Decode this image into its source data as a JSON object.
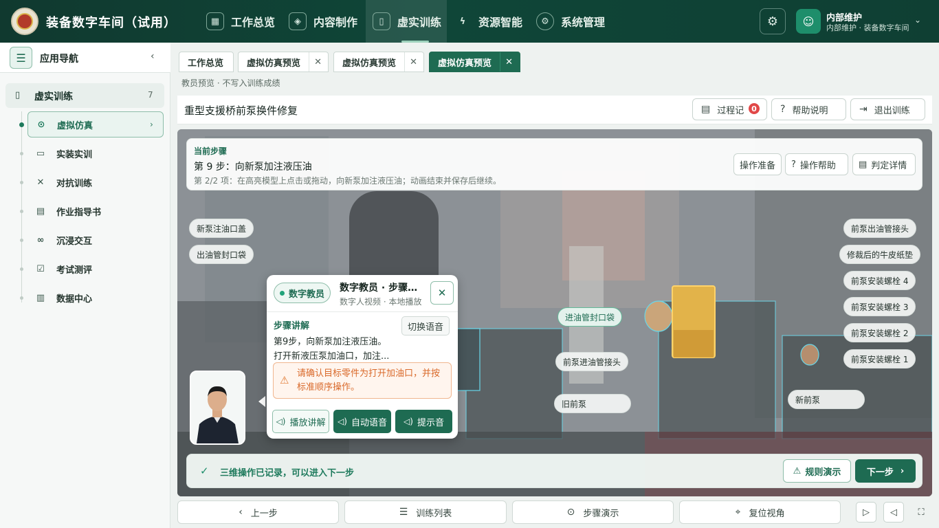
{
  "app": {
    "title": "装备数字车间（试用）"
  },
  "topnav": [
    {
      "label": "工作总览",
      "icon": "grid-icon"
    },
    {
      "label": "内容制作",
      "icon": "cube-icon"
    },
    {
      "label": "虚实训练",
      "icon": "book-icon"
    },
    {
      "label": "资源智能",
      "icon": "bolt-icon"
    },
    {
      "label": "系统管理",
      "icon": "gear-icon"
    }
  ],
  "user": {
    "name": "内部维护",
    "sub": "内部维护 · 装备数字车间"
  },
  "sidebar": {
    "title": "应用导航",
    "group": {
      "label": "虚实训练",
      "count": "7"
    },
    "items": [
      {
        "label": "虚拟仿真",
        "icon": "play-circle-icon"
      },
      {
        "label": "实装实训",
        "icon": "monitor-icon"
      },
      {
        "label": "对抗训练",
        "icon": "combat-icon"
      },
      {
        "label": "作业指导书",
        "icon": "document-icon"
      },
      {
        "label": "沉浸交互",
        "icon": "vr-icon"
      },
      {
        "label": "考试测评",
        "icon": "exam-icon"
      },
      {
        "label": "数据中心",
        "icon": "chart-icon"
      }
    ]
  },
  "tabs": [
    {
      "label": "工作总览"
    },
    {
      "label": "虚拟仿真预览"
    },
    {
      "label": "虚拟仿真预览"
    },
    {
      "label": "虚拟仿真预览"
    }
  ],
  "breadcrumb": "教员预览 · 不写入训练成绩",
  "header": {
    "title": "重型支援桥前泵换件修复",
    "log_label": "过程记",
    "log_badge": "0",
    "help_label": "帮助说明",
    "exit_label": "退出训练"
  },
  "step": {
    "kicker": "当前步骤",
    "title": "第 9 步：向新泵加注液压油",
    "sub": "第 2/2 项：在高亮模型上点击或拖动，向新泵加注液压油；动画结束并保存后继续。",
    "btn_prep": "操作准备",
    "btn_help": "操作帮助",
    "btn_judge": "判定详情"
  },
  "labels": {
    "a": "新泵注油口盖",
    "b": "出油管封口袋",
    "c": "进油管封口袋",
    "d": "前泵进油管接头",
    "e": "旧前泵",
    "f": "新前泵",
    "r1": "前泵出油管接头",
    "r2": "修裁后的牛皮纸垫",
    "r3": "前泵安装螺栓 4",
    "r4": "前泵安装螺栓 3",
    "r5": "前泵安装螺栓 2",
    "r6": "前泵安装螺栓 1"
  },
  "teacher": {
    "pill": "数字教员",
    "name": "数字教员 · 步骤讲解",
    "meta": "数字人视频 · 本地播放",
    "section": "步骤讲解",
    "switch": "切换语音",
    "line1": "第9步，向新泵加注液压油。",
    "line2": "打开新液压泵加油口，加注...",
    "warning": "请确认目标零件为打开加油口，并按标准顺序操作。",
    "btn_play": "播放讲解",
    "btn_auto": "自动语音",
    "btn_tone": "提示音"
  },
  "status": {
    "text": "三维操作已记录，可以进入下一步",
    "rule": "规则演示",
    "next": "下一步"
  },
  "bottom": {
    "prev": "上一步",
    "list": "训练列表",
    "demo": "步骤演示",
    "reset": "复位视角"
  }
}
